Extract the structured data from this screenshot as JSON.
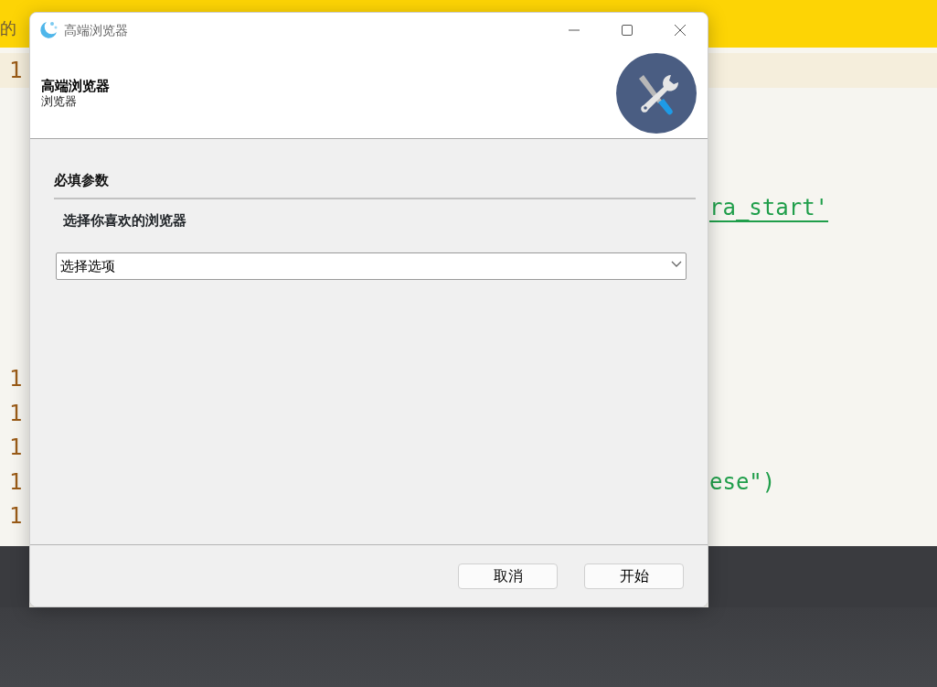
{
  "background": {
    "banner_text": "的",
    "code_lines": [
      {
        "number": "1"
      },
      {
        "code": "ra_start'",
        "underlined": true
      },
      {
        "number": "1"
      },
      {
        "number": "1"
      },
      {
        "number": "1"
      },
      {
        "number": "1",
        "code": "ese\")",
        "underlined": false
      },
      {
        "number": "1"
      }
    ]
  },
  "dialog": {
    "title": "高端浏览器",
    "header": {
      "title": "高端浏览器",
      "subtitle": "浏览器"
    },
    "section": {
      "title": "必填参数",
      "label": "选择你喜欢的浏览器",
      "select": {
        "placeholder": "选择选项"
      }
    },
    "buttons": [
      {
        "label": "取消"
      },
      {
        "label": "开始"
      }
    ]
  }
}
